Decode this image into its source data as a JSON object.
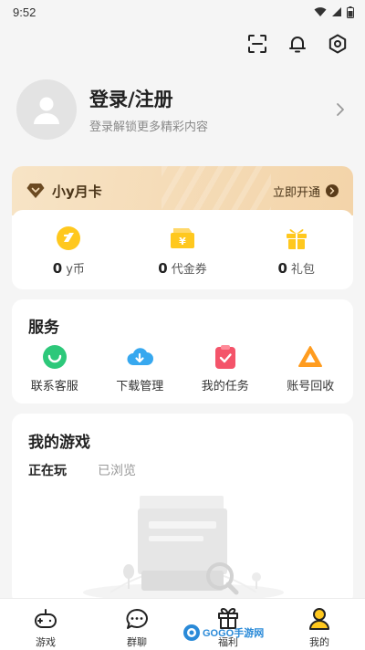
{
  "status_bar": {
    "time": "9:52"
  },
  "profile": {
    "title": "登录/注册",
    "subtitle": "登录解锁更多精彩内容"
  },
  "vip": {
    "title": "小y月卡",
    "open_label": "立即开通",
    "assets": [
      {
        "value": "0",
        "label": "y币",
        "icon": "y-coin-icon"
      },
      {
        "value": "0",
        "label": "代金券",
        "icon": "voucher-icon"
      },
      {
        "value": "0",
        "label": "礼包",
        "icon": "gift-icon"
      }
    ]
  },
  "services": {
    "title": "服务",
    "items": [
      {
        "label": "联系客服",
        "icon": "customer-service-icon"
      },
      {
        "label": "下载管理",
        "icon": "download-cloud-icon"
      },
      {
        "label": "我的任务",
        "icon": "task-icon"
      },
      {
        "label": "账号回收",
        "icon": "account-recycle-icon"
      }
    ]
  },
  "games": {
    "title": "我的游戏",
    "tabs": [
      {
        "label": "正在玩",
        "active": true
      },
      {
        "label": "已浏览",
        "active": false
      }
    ]
  },
  "bottom_nav": [
    {
      "label": "游戏",
      "icon": "gamepad-icon"
    },
    {
      "label": "群聊",
      "icon": "chat-icon"
    },
    {
      "label": "福利",
      "icon": "gift-box-icon"
    },
    {
      "label": "我的",
      "icon": "user-icon",
      "active": true
    }
  ],
  "watermark": {
    "text": "GOGO手游网"
  },
  "colors": {
    "accent_yellow": "#ffc81e",
    "vip_gold": "#f5dcb8",
    "vip_text": "#4a3418",
    "background": "#f5f5f5"
  }
}
